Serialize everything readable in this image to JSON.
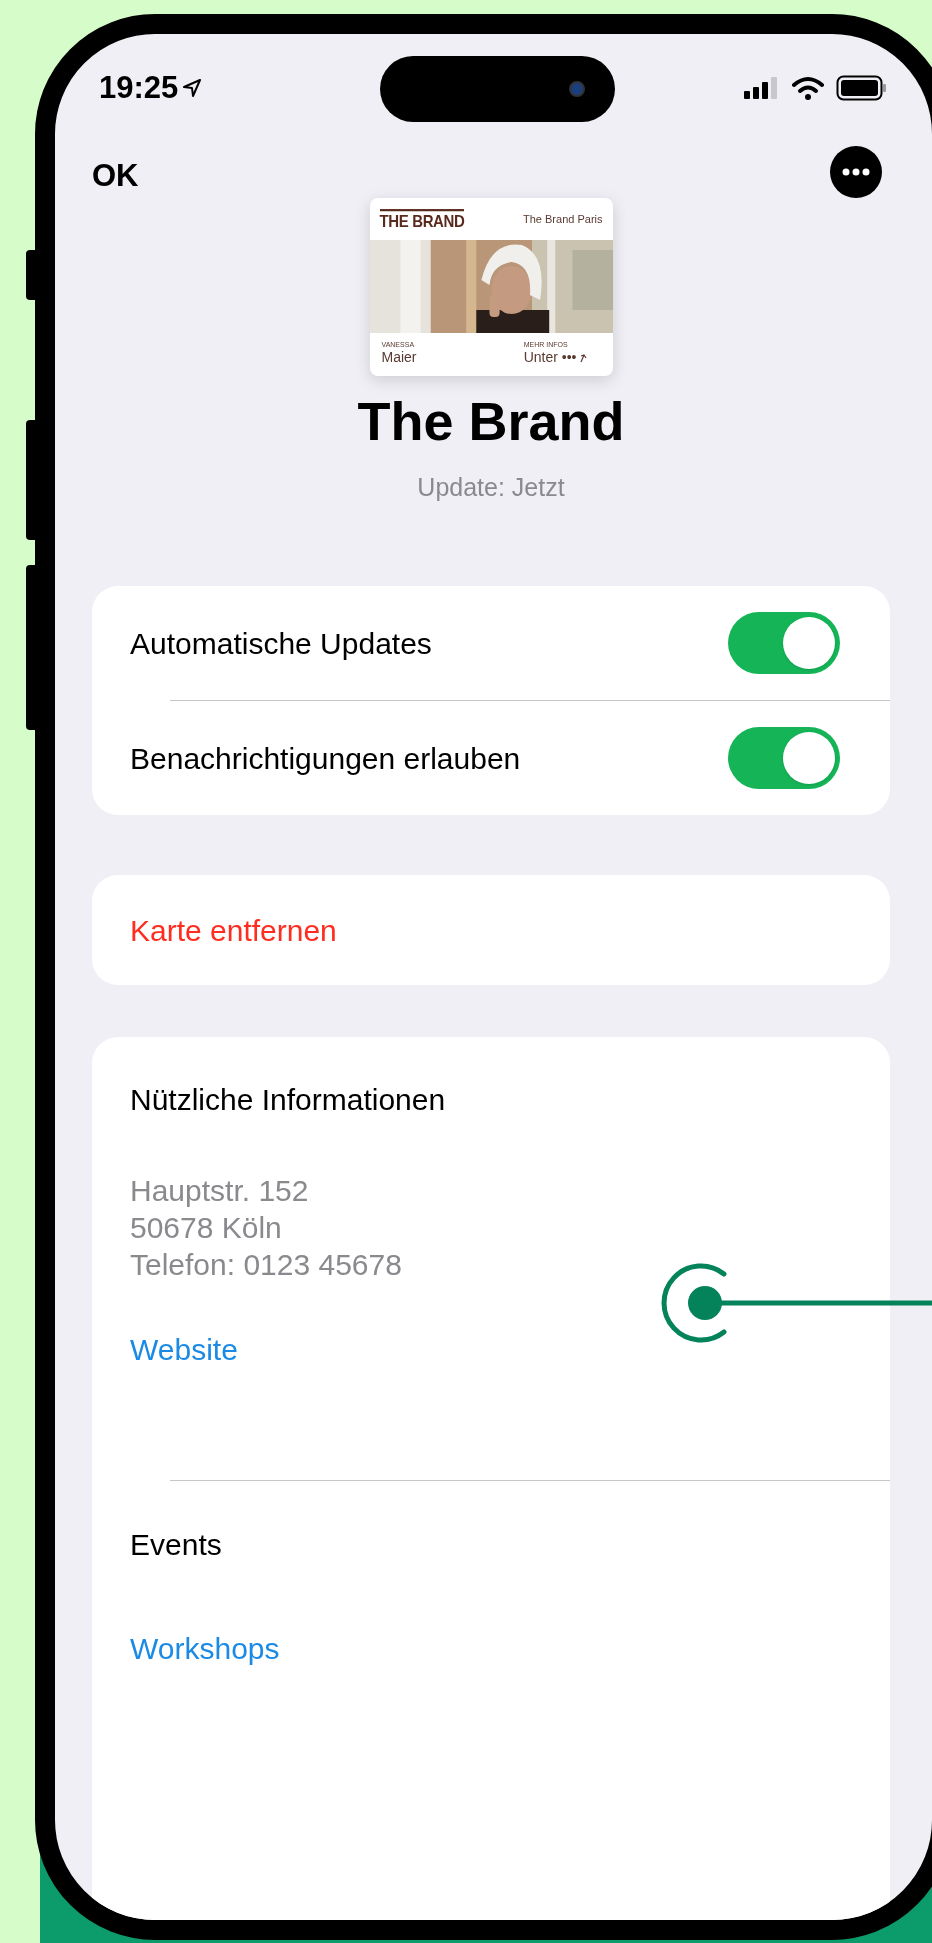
{
  "status_bar": {
    "time": "19:25"
  },
  "nav": {
    "done": "OK"
  },
  "pass": {
    "logo": "THE BRAND",
    "subtitle": "The Brand Paris",
    "field_1_label": "VANESSA",
    "field_1_value": "Maier",
    "field_2_label": "MEHR INFOS",
    "field_2_value": "Unter •••"
  },
  "title": "The Brand",
  "subtitle": "Update: Jetzt",
  "settings": [
    {
      "label": "Automatische Updates",
      "on": true
    },
    {
      "label": "Benachrichtigungen erlauben",
      "on": true
    }
  ],
  "remove_button": "Karte entfernen",
  "info": {
    "heading": "Nützliche Informationen",
    "address_lines": [
      "Hauptstr. 152",
      "50678 Köln",
      "Telefon: 0123 45678"
    ],
    "link": "Website"
  },
  "events": {
    "heading": "Events",
    "link": "Workshops"
  }
}
